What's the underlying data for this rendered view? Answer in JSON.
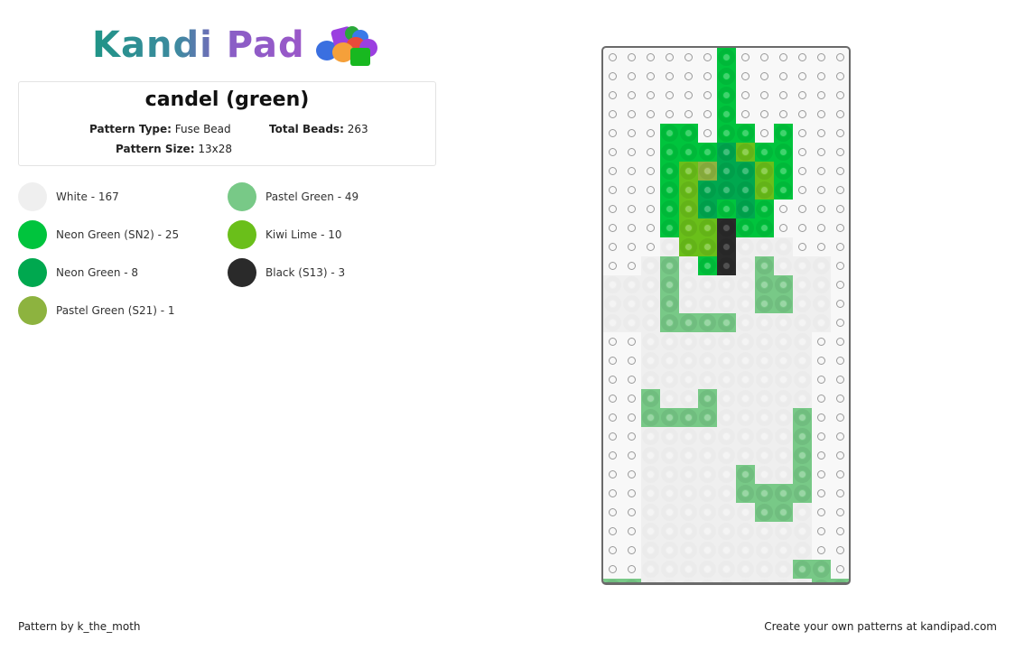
{
  "logo": {
    "text": "Kandi Pad",
    "icon": "beads-icon"
  },
  "pattern": {
    "title": "candel (green)",
    "type_label": "Pattern Type:",
    "type_value": "Fuse Bead",
    "total_label": "Total Beads:",
    "total_value": "263",
    "size_label": "Pattern Size:",
    "size_value": "13x28"
  },
  "legend": [
    {
      "key": "W",
      "label": "White - 167",
      "color": "#efefef"
    },
    {
      "key": "P",
      "label": "Pastel Green - 49",
      "color": "#78c987"
    },
    {
      "key": "N",
      "label": "Neon Green (SN2) - 25",
      "color": "#00c43d"
    },
    {
      "key": "K",
      "label": "Kiwi Lime - 10",
      "color": "#6abf1a"
    },
    {
      "key": "D",
      "label": "Neon Green - 8",
      "color": "#00a84f"
    },
    {
      "key": "B",
      "label": "Black (S13) - 3",
      "color": "#2a2a2a"
    },
    {
      "key": "S",
      "label": "Pastel Green (S21) - 1",
      "color": "#8db33f"
    }
  ],
  "grid": {
    "columns": 13,
    "rows": [
      "......N......",
      "......N......",
      "......N......",
      "......N......",
      "...NN.NN.N...",
      "...NNNDKNN...",
      "...NKSDDKN...",
      "...NKDDDKN...",
      "...NKDNDN....",
      "...NKKBNN....",
      "...WKKBWWW...",
      "..WPWNBWPWWW.",
      "WWWPWWWWPPWW.",
      "WWWPWWWWPPWW.",
      "WWWPPPPWWWWW.",
      "..WWWWWWWWW..",
      "..WWWWWWWWW..",
      "..WWWWWWWWW..",
      "..PWWPWWWWW..",
      "..PPPPWWWWP..",
      "..WWWWWWWWP..",
      "..WWWWWWWWP..",
      "..WWWWWPWWP..",
      "..WWWWWPPPP..",
      "..WWWWWWPPW..",
      "..WWWWWWWWW..",
      "..WWWWWWWWW..",
      "..WWWWWWWWPP.",
      "PPWWWWWWWWWPP"
    ]
  },
  "footer": {
    "credit": "Pattern by k_the_moth",
    "promo": "Create your own patterns at kandipad.com"
  }
}
